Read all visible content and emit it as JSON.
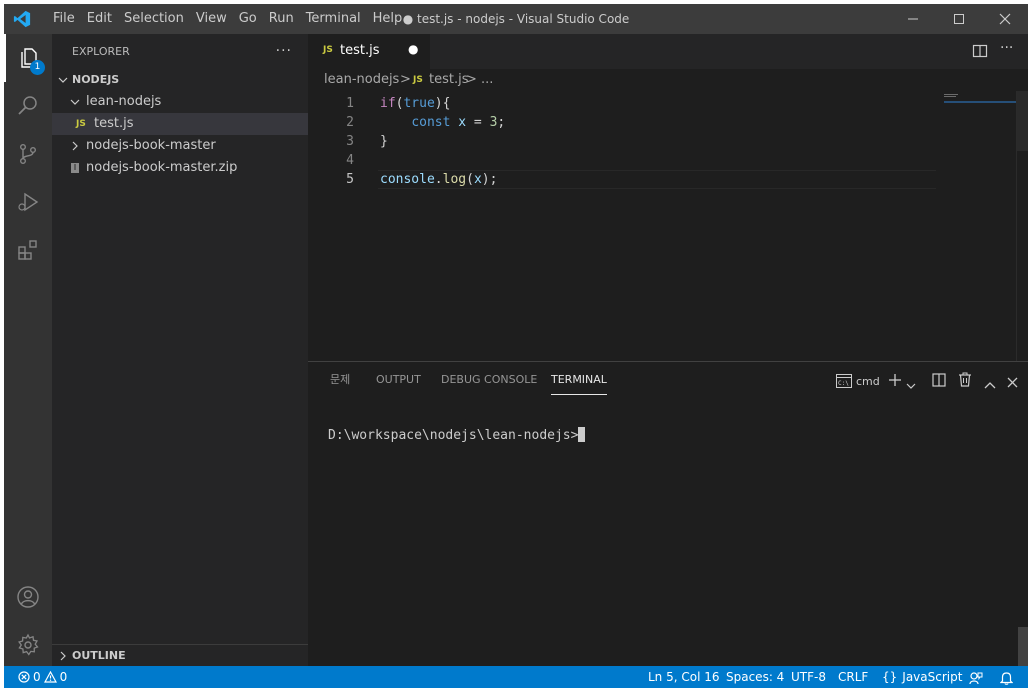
{
  "titlebar": {
    "menu": [
      "File",
      "Edit",
      "Selection",
      "View",
      "Go",
      "Run",
      "Terminal",
      "Help"
    ],
    "title": "● test.js - nodejs - Visual Studio Code"
  },
  "activity": {
    "explorer_badge": "1"
  },
  "sidebar": {
    "header": "EXPLORER",
    "more": "···",
    "root": "NODEJS",
    "items": [
      {
        "label": "lean-nodejs"
      },
      {
        "label": "test.js",
        "icon_text": "JS"
      },
      {
        "label": "nodejs-book-master"
      },
      {
        "label": "nodejs-book-master.zip"
      }
    ],
    "outline": "OUTLINE"
  },
  "editor": {
    "tab": {
      "icon_text": "JS",
      "label": "test.js",
      "dirty": "●"
    },
    "breadcrumb": {
      "folder": "lean-nodejs",
      "sep": ">",
      "icon_text": "JS",
      "file": "test.js",
      "tail": "> ..."
    },
    "line_numbers": [
      "1",
      "2",
      "3",
      "4",
      "5"
    ]
  },
  "panel": {
    "tabs": [
      "문제",
      "OUTPUT",
      "DEBUG CONSOLE",
      "TERMINAL"
    ],
    "shell": "cmd",
    "prompt": "D:\\workspace\\nodejs\\lean-nodejs>"
  },
  "status": {
    "errors": "0",
    "warnings": "0",
    "position": "Ln 5, Col 16",
    "spaces": "Spaces: 4",
    "encoding": "UTF-8",
    "eol": "CRLF",
    "language": "JavaScript",
    "braces": "{}"
  },
  "colors": {
    "accent": "#007acc",
    "activity_bar": "#333333",
    "sidebar": "#252526",
    "editor": "#1e1e1e",
    "titlebar": "#3c3c3c"
  }
}
